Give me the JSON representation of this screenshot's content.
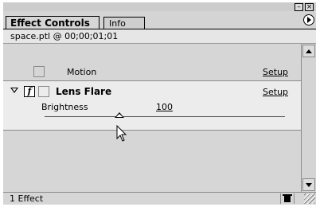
{
  "window": {
    "minimize_glyph": "–",
    "close_glyph": "×"
  },
  "tabs": {
    "active_label": "Effect Controls",
    "inactive_label": "Info",
    "menu_icon": "panel-menu-arrow-icon"
  },
  "clip": {
    "label": "space.ptl @ 00;00;01;01"
  },
  "effects": {
    "motion": {
      "label": "Motion",
      "setup_label": "Setup"
    },
    "lens_flare": {
      "fx_glyph": "f",
      "label": "Lens Flare",
      "setup_label": "Setup",
      "param_label": "Brightness",
      "param_value": "100",
      "slider_fraction": 0.31
    }
  },
  "status": {
    "count_label": "1 Effect",
    "trash_icon": "trash-icon",
    "grip_icon": "resize-grip-icon"
  },
  "colors": {
    "selected_row": "#ececec",
    "panel": "#d6d6d6"
  }
}
